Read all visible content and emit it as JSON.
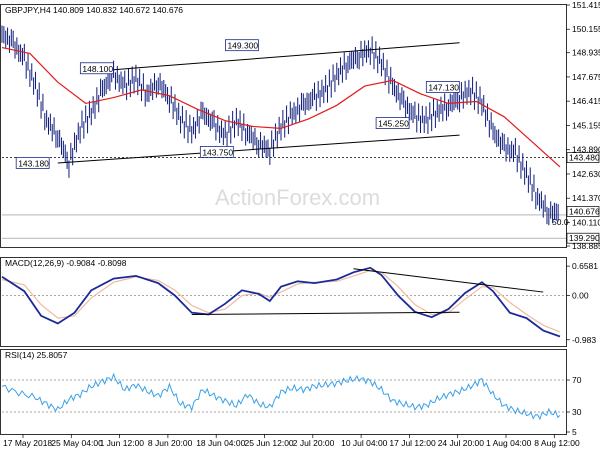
{
  "chart_data": [
    {
      "type": "line",
      "title": "GBPJPY,H4  140.809 140.832 140.672 140.676",
      "ylim": [
        138.885,
        151.415
      ],
      "y_ticks": [
        151.415,
        150.155,
        148.935,
        147.675,
        146.415,
        145.155,
        143.89,
        142.63,
        141.37,
        140.11,
        138.885
      ],
      "price_tags": {
        "last": "140.676",
        "level1": "143.480",
        "level2": "139.290"
      },
      "level_lines": [
        {
          "label": "50.0",
          "value": 140.5
        },
        {
          "value": 143.48
        },
        {
          "value": 139.29
        }
      ],
      "annotations": [
        {
          "label": "148.100",
          "x": 0.17,
          "y": 148.1
        },
        {
          "label": "149.300",
          "x": 0.43,
          "y": 149.3
        },
        {
          "label": "143.180",
          "x": 0.055,
          "y": 143.18
        },
        {
          "label": "143.750",
          "x": 0.385,
          "y": 143.75
        },
        {
          "label": "147.130",
          "x": 0.79,
          "y": 147.13
        },
        {
          "label": "145.250",
          "x": 0.7,
          "y": 145.25
        }
      ],
      "series": [
        {
          "values": [
            [
              0,
              149.9
            ],
            [
              0.02,
              149.4
            ],
            [
              0.04,
              148.6
            ],
            [
              0.06,
              147.2
            ],
            [
              0.08,
              145.4
            ],
            [
              0.1,
              144.6
            ],
            [
              0.12,
              143.2
            ],
            [
              0.14,
              145.0
            ],
            [
              0.16,
              145.8
            ],
            [
              0.18,
              147.0
            ],
            [
              0.2,
              147.8
            ],
            [
              0.22,
              147.2
            ],
            [
              0.24,
              147.6
            ],
            [
              0.26,
              146.8
            ],
            [
              0.28,
              147.4
            ],
            [
              0.3,
              146.6
            ],
            [
              0.32,
              145.5
            ],
            [
              0.34,
              144.8
            ],
            [
              0.36,
              145.8
            ],
            [
              0.38,
              145.2
            ],
            [
              0.4,
              144.6
            ],
            [
              0.42,
              145.4
            ],
            [
              0.44,
              144.8
            ],
            [
              0.46,
              144.2
            ],
            [
              0.48,
              143.9
            ],
            [
              0.5,
              145.1
            ],
            [
              0.52,
              145.7
            ],
            [
              0.54,
              146.2
            ],
            [
              0.56,
              146.6
            ],
            [
              0.58,
              147.0
            ],
            [
              0.6,
              147.8
            ],
            [
              0.62,
              148.4
            ],
            [
              0.64,
              148.8
            ],
            [
              0.66,
              149.1
            ],
            [
              0.68,
              148.4
            ],
            [
              0.7,
              147.2
            ],
            [
              0.72,
              146.3
            ],
            [
              0.74,
              145.6
            ],
            [
              0.76,
              145.4
            ],
            [
              0.78,
              145.9
            ],
            [
              0.8,
              146.2
            ],
            [
              0.82,
              146.6
            ],
            [
              0.84,
              147.0
            ],
            [
              0.86,
              146.3
            ],
            [
              0.88,
              144.8
            ],
            [
              0.9,
              144.0
            ],
            [
              0.92,
              143.7
            ],
            [
              0.94,
              142.6
            ],
            [
              0.96,
              141.4
            ],
            [
              0.98,
              140.6
            ],
            [
              1.0,
              140.676
            ]
          ]
        },
        {
          "values": [
            [
              0,
              149.2
            ],
            [
              0.05,
              148.9
            ],
            [
              0.1,
              147.4
            ],
            [
              0.15,
              146.3
            ],
            [
              0.2,
              146.6
            ],
            [
              0.25,
              147.0
            ],
            [
              0.3,
              146.7
            ],
            [
              0.35,
              146.0
            ],
            [
              0.4,
              145.4
            ],
            [
              0.45,
              145.1
            ],
            [
              0.5,
              145.0
            ],
            [
              0.55,
              145.5
            ],
            [
              0.6,
              146.2
            ],
            [
              0.65,
              147.2
            ],
            [
              0.7,
              147.5
            ],
            [
              0.75,
              146.8
            ],
            [
              0.8,
              146.3
            ],
            [
              0.85,
              146.4
            ],
            [
              0.9,
              145.6
            ],
            [
              0.95,
              144.3
            ],
            [
              1.0,
              143.0
            ]
          ]
        }
      ],
      "trendlines": [
        {
          "from": [
            0.2,
            148.05
          ],
          "to": [
            0.82,
            149.45
          ]
        },
        {
          "from": [
            0.1,
            143.2
          ],
          "to": [
            0.82,
            144.65
          ]
        }
      ]
    },
    {
      "type": "line",
      "title": "MACD(12,26,9) -0.9084 -0.8098",
      "ylim": [
        -1.1,
        0.75
      ],
      "y_ticks": [
        0.6581,
        0.0,
        -0.983
      ],
      "series": [
        {
          "values": [
            [
              0,
              0.42
            ],
            [
              0.04,
              0.1
            ],
            [
              0.07,
              -0.45
            ],
            [
              0.1,
              -0.62
            ],
            [
              0.13,
              -0.38
            ],
            [
              0.16,
              0.12
            ],
            [
              0.2,
              0.38
            ],
            [
              0.24,
              0.44
            ],
            [
              0.28,
              0.28
            ],
            [
              0.31,
              0.0
            ],
            [
              0.34,
              -0.38
            ],
            [
              0.37,
              -0.42
            ],
            [
              0.4,
              -0.18
            ],
            [
              0.43,
              0.12
            ],
            [
              0.46,
              0.04
            ],
            [
              0.48,
              -0.12
            ],
            [
              0.5,
              0.2
            ],
            [
              0.53,
              0.32
            ],
            [
              0.56,
              0.28
            ],
            [
              0.6,
              0.36
            ],
            [
              0.63,
              0.52
            ],
            [
              0.66,
              0.62
            ],
            [
              0.68,
              0.46
            ],
            [
              0.71,
              0.0
            ],
            [
              0.74,
              -0.36
            ],
            [
              0.77,
              -0.48
            ],
            [
              0.8,
              -0.3
            ],
            [
              0.83,
              0.06
            ],
            [
              0.86,
              0.3
            ],
            [
              0.88,
              0.1
            ],
            [
              0.91,
              -0.38
            ],
            [
              0.94,
              -0.5
            ],
            [
              0.97,
              -0.78
            ],
            [
              1.0,
              -0.91
            ]
          ]
        },
        {
          "values": [
            [
              0,
              0.36
            ],
            [
              0.04,
              0.24
            ],
            [
              0.07,
              -0.2
            ],
            [
              0.1,
              -0.5
            ],
            [
              0.13,
              -0.45
            ],
            [
              0.16,
              -0.05
            ],
            [
              0.2,
              0.3
            ],
            [
              0.24,
              0.42
            ],
            [
              0.28,
              0.34
            ],
            [
              0.31,
              0.12
            ],
            [
              0.34,
              -0.22
            ],
            [
              0.37,
              -0.38
            ],
            [
              0.4,
              -0.3
            ],
            [
              0.43,
              0.0
            ],
            [
              0.46,
              0.06
            ],
            [
              0.48,
              -0.04
            ],
            [
              0.5,
              0.08
            ],
            [
              0.53,
              0.26
            ],
            [
              0.56,
              0.3
            ],
            [
              0.6,
              0.32
            ],
            [
              0.63,
              0.44
            ],
            [
              0.66,
              0.56
            ],
            [
              0.68,
              0.52
            ],
            [
              0.71,
              0.2
            ],
            [
              0.74,
              -0.2
            ],
            [
              0.77,
              -0.42
            ],
            [
              0.8,
              -0.38
            ],
            [
              0.83,
              -0.08
            ],
            [
              0.86,
              0.2
            ],
            [
              0.88,
              0.18
            ],
            [
              0.91,
              -0.15
            ],
            [
              0.94,
              -0.42
            ],
            [
              0.97,
              -0.66
            ],
            [
              1.0,
              -0.81
            ]
          ]
        }
      ],
      "trendlines": [
        {
          "from": [
            0.34,
            -0.42
          ],
          "to": [
            0.82,
            -0.37
          ]
        },
        {
          "from": [
            0.63,
            0.6
          ],
          "to": [
            0.97,
            0.08
          ]
        }
      ]
    },
    {
      "type": "line",
      "title": "RSI(14) 25.8057",
      "ylim": [
        5,
        95
      ],
      "y_ticks": [
        70,
        30,
        5
      ],
      "series": [
        {
          "values": [
            [
              0,
              62
            ],
            [
              0.03,
              54
            ],
            [
              0.06,
              48
            ],
            [
              0.08,
              40
            ],
            [
              0.1,
              33
            ],
            [
              0.12,
              46
            ],
            [
              0.14,
              52
            ],
            [
              0.16,
              62
            ],
            [
              0.18,
              68
            ],
            [
              0.2,
              74
            ],
            [
              0.22,
              58
            ],
            [
              0.24,
              64
            ],
            [
              0.26,
              56
            ],
            [
              0.28,
              50
            ],
            [
              0.3,
              62
            ],
            [
              0.32,
              40
            ],
            [
              0.34,
              36
            ],
            [
              0.36,
              58
            ],
            [
              0.38,
              50
            ],
            [
              0.4,
              44
            ],
            [
              0.42,
              38
            ],
            [
              0.44,
              52
            ],
            [
              0.46,
              40
            ],
            [
              0.48,
              36
            ],
            [
              0.5,
              55
            ],
            [
              0.52,
              60
            ],
            [
              0.54,
              58
            ],
            [
              0.56,
              62
            ],
            [
              0.58,
              64
            ],
            [
              0.6,
              66
            ],
            [
              0.62,
              70
            ],
            [
              0.64,
              72
            ],
            [
              0.66,
              68
            ],
            [
              0.68,
              58
            ],
            [
              0.7,
              44
            ],
            [
              0.72,
              40
            ],
            [
              0.74,
              36
            ],
            [
              0.76,
              38
            ],
            [
              0.78,
              46
            ],
            [
              0.8,
              52
            ],
            [
              0.82,
              56
            ],
            [
              0.84,
              62
            ],
            [
              0.86,
              70
            ],
            [
              0.88,
              52
            ],
            [
              0.9,
              38
            ],
            [
              0.92,
              32
            ],
            [
              0.94,
              28
            ],
            [
              0.96,
              24
            ],
            [
              0.98,
              30
            ],
            [
              1.0,
              25.8
            ]
          ]
        }
      ]
    }
  ],
  "x_axis": {
    "labels": [
      "17 May 2018",
      "25 May 04:00",
      "1 Jun 12:00",
      "8 Jun 20:00",
      "18 Jun 04:00",
      "25 Jun 12:00",
      "2 Jul 20:00",
      "10 Jul 04:00",
      "17 Jul 12:00",
      "24 Jul 20:00",
      "1 Aug 04:00",
      "8 Aug 12:00"
    ]
  },
  "watermark": "ActionForex.com",
  "colors": {
    "price": "#0c1a7a",
    "ma": "#e21b1b",
    "macd": "#1b2a9a",
    "signal": "#f0b9a0",
    "rsi": "#3aa0e8",
    "grid": "#9a9a9a"
  }
}
